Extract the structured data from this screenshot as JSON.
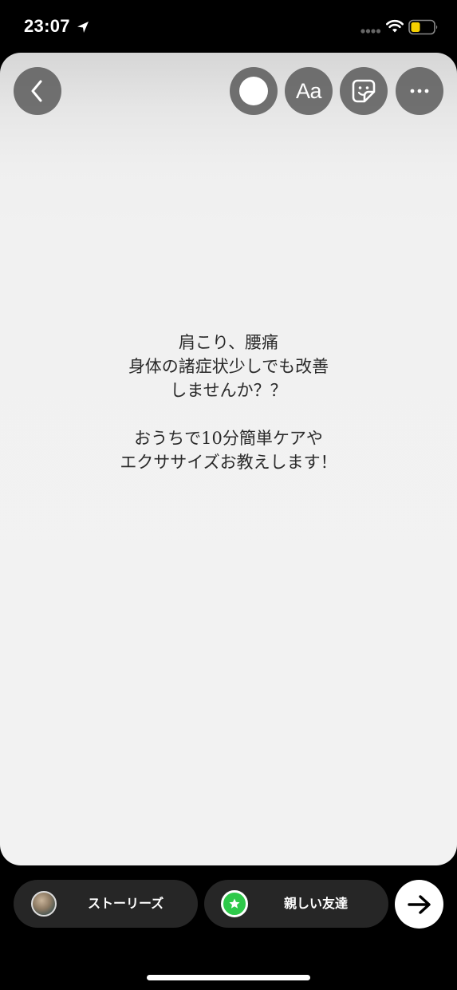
{
  "status_bar": {
    "time": "23:07",
    "icons": [
      "location-arrow-icon",
      "signal-icon",
      "wifi-icon",
      "battery-icon"
    ],
    "battery_color": "#f5d000"
  },
  "toolbar": {
    "back_icon": "chevron-left-icon",
    "color_icon": "color-dot-icon",
    "text_label": "Aa",
    "sticker_icon": "sticker-icon",
    "more_icon": "more-icon"
  },
  "story": {
    "lines": [
      "肩こり、腰痛",
      "身体の諸症状少しでも改善",
      "しませんか？？",
      "",
      "おうちで10分簡単ケアや",
      "エクササイズお教えします！"
    ],
    "background": "#f2f2f2",
    "text_color": "#2a2a2a"
  },
  "share_bar": {
    "stories_label": "ストーリーズ",
    "close_friends_label": "親しい友達",
    "close_friends_color": "#2ec94a",
    "next_icon": "arrow-right-icon"
  }
}
